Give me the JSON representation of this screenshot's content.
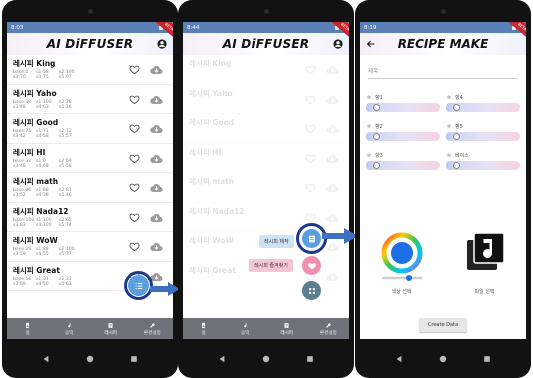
{
  "app": {
    "title": "AI DiFFUSER",
    "recipe_title": "RECIPE MAKE",
    "beta_ribbon": "BETA"
  },
  "status": {
    "time_1": "8:03",
    "time_2": "8:44",
    "time_3": "8:19"
  },
  "recipes": [
    {
      "name": "레시피 King",
      "stats": [
        "base:0",
        "s1:58",
        "s2:100",
        "s3:70",
        "s4:75",
        "s5:97"
      ]
    },
    {
      "name": "레시피 Yaho",
      "stats": [
        "base:39",
        "s1:100",
        "s2:28",
        "s3:48",
        "s4:63",
        "s5:36"
      ]
    },
    {
      "name": "레시피 Good",
      "stats": [
        "base:75",
        "s1:71",
        "s2:72",
        "s3:42",
        "s4:58",
        "s5:57"
      ]
    },
    {
      "name": "레시피 HI",
      "stats": [
        "base:31",
        "s1:0",
        "s2:69",
        "s3:48",
        "s4:68",
        "s5:58"
      ]
    },
    {
      "name": "레시피 math",
      "stats": [
        "base:96",
        "s1:88",
        "s2:81",
        "s3:52",
        "s4:38",
        "s5:46"
      ]
    },
    {
      "name": "레시피 Nada12",
      "stats": [
        "base:100",
        "s1:100",
        "s2:65",
        "s3:83",
        "s4:100",
        "s5:74"
      ]
    },
    {
      "name": "레시피 WoW",
      "stats": [
        "base:26",
        "s1:88",
        "s2:100",
        "s3:59",
        "s4:55",
        "s5:77"
      ]
    },
    {
      "name": "레시피 Great",
      "stats": [
        "base:56",
        "s1:31",
        "s2:33",
        "s3:69",
        "s4:50",
        "s5:63"
      ]
    }
  ],
  "faded_names": [
    "레시피 King",
    "레시피 Yaho",
    "레시피 Good",
    "레시피 HI",
    "레시피 math",
    "레시피 Nada12",
    "레시피 WoW",
    "레시피 Great"
  ],
  "bottom_nav": [
    {
      "label": "홈",
      "icon": "speaker-icon"
    },
    {
      "label": "음악",
      "icon": "music-note-icon"
    },
    {
      "label": "레시피",
      "icon": "list-icon",
      "active": true
    },
    {
      "label": "환경설정",
      "icon": "wrench-icon"
    }
  ],
  "fab_menu": {
    "write_label": "레시피 제작",
    "favorites_label": "레시피 즐겨찾기"
  },
  "recipe_make": {
    "title_placeholder": "제목",
    "sliders_left": [
      {
        "label": "향1",
        "value": 0.05
      },
      {
        "label": "향2",
        "value": 0.05
      },
      {
        "label": "향3",
        "value": 0.05
      }
    ],
    "sliders_right": [
      {
        "label": "향4",
        "value": 0.05
      },
      {
        "label": "향5",
        "value": 0.05
      },
      {
        "label": "베이스",
        "value": 0.05
      }
    ],
    "color_caption": "색상 선택",
    "file_caption": "파일 선택",
    "create_label": "Create Data"
  },
  "colors": {
    "accent": "#2f6fd6",
    "nav": "#6e7379",
    "highlight": "#1d3a8a",
    "arrow": "#3f6fc0",
    "fab_blue": "#5b9ee0",
    "fab_pink": "#f08fb0"
  }
}
